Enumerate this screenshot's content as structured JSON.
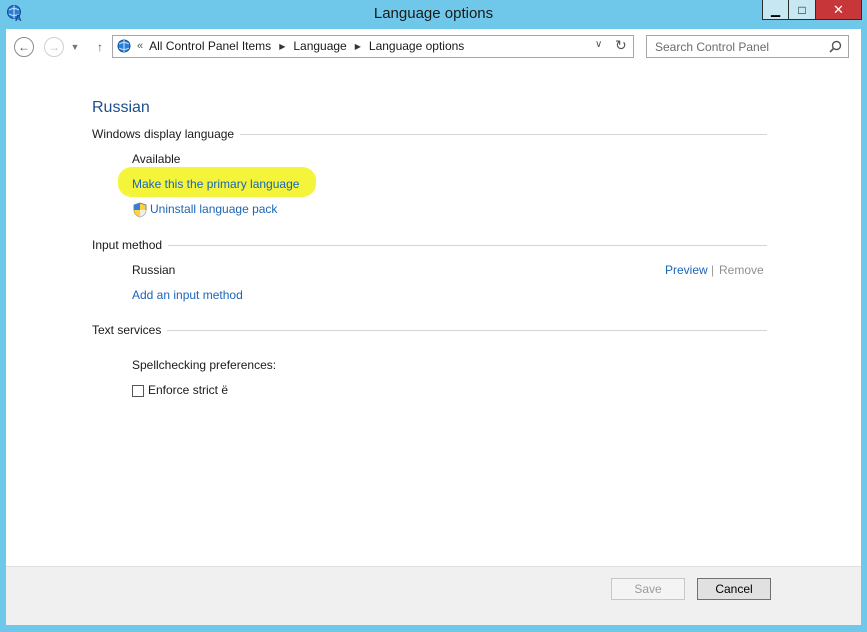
{
  "window": {
    "title": "Language options",
    "min_glyph": "▁",
    "max_glyph": "□",
    "close_glyph": "✕"
  },
  "nav": {
    "back_glyph": "←",
    "forward_glyph": "→",
    "history_glyph": "▼",
    "up_glyph": "↑",
    "breadcrumb_lead": "«",
    "breadcrumbs": [
      "All Control Panel Items",
      "Language",
      "Language options"
    ],
    "breadcrumb_sep": "▶",
    "dropdown_glyph": "∨",
    "refresh_glyph": "↻"
  },
  "search": {
    "placeholder": "Search Control Panel",
    "value": ""
  },
  "content": {
    "heading": "Russian",
    "display_language": {
      "section_title": "Windows display language",
      "status": "Available",
      "primary_link": "Make this the primary language",
      "uninstall_link": "Uninstall language pack"
    },
    "input_method": {
      "section_title": "Input method",
      "method_name": "Russian",
      "preview_link": "Preview",
      "separator": "|",
      "remove_link": "Remove",
      "add_link": "Add an input method"
    },
    "text_services": {
      "section_title": "Text services",
      "spellcheck_label": "Spellchecking preferences:",
      "checkbox_label": "Enforce strict ё",
      "checkbox_checked": false
    }
  },
  "footer": {
    "save_label": "Save",
    "cancel_label": "Cancel"
  },
  "colors": {
    "titlebar": "#6fc7ea",
    "close_button": "#c7373a",
    "link": "#1c65b8",
    "heading": "#1e4f8c",
    "highlight": "#f4f43a"
  },
  "icons": {
    "app": "language-globe-icon",
    "shield": "uac-shield-icon",
    "search": "search-icon"
  }
}
